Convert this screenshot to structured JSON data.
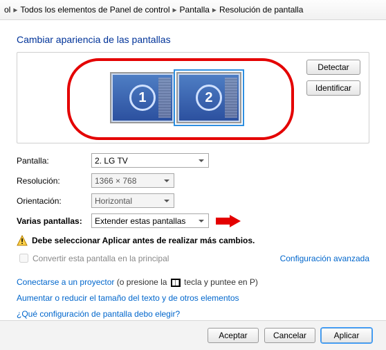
{
  "breadcrumb": {
    "a": "ol",
    "b": "Todos los elementos de Panel de control",
    "c": "Pantalla",
    "d": "Resolución de pantalla"
  },
  "title": "Cambiar apariencia de las pantallas",
  "side": {
    "detect": "Detectar",
    "identify": "Identificar"
  },
  "monitors": {
    "m1": "1",
    "m2": "2"
  },
  "form": {
    "screen_label": "Pantalla:",
    "screen_value": "2. LG TV",
    "res_label": "Resolución:",
    "res_value": "1366 × 768",
    "orient_label": "Orientación:",
    "orient_value": "Horizontal",
    "multi_label": "Varias pantallas:",
    "multi_value": "Extender estas pantallas"
  },
  "warning": "Debe seleccionar Aplicar antes de realizar más cambios.",
  "make_primary": "Convertir esta pantalla en la principal",
  "advanced": "Configuración avanzada",
  "links": {
    "projector": "Conectarse a un proyector",
    "projector_tail_a": " (o presione la ",
    "projector_tail_b": " tecla y puntee en P)",
    "textsize": "Aumentar o reducir el tamaño del texto y de otros elementos",
    "which": "¿Qué configuración de pantalla debo elegir?"
  },
  "footer": {
    "ok": "Aceptar",
    "cancel": "Cancelar",
    "apply": "Aplicar"
  }
}
